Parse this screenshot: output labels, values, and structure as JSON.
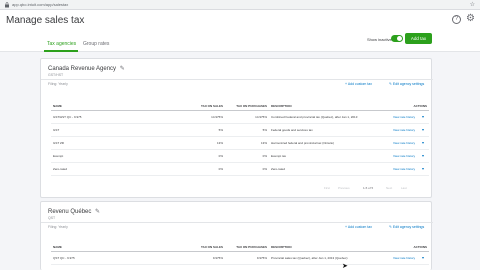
{
  "browser": {
    "url": "app.qbo.intuit.com/app/salestax"
  },
  "header": {
    "title": "Manage sales tax"
  },
  "tabs": [
    {
      "label": "Tax agencies",
      "active": true
    },
    {
      "label": "Group rates",
      "active": false
    }
  ],
  "toolbar": {
    "toggle_label": "Show inactive",
    "add_tax_label": "Add tax"
  },
  "agencies": [
    {
      "name": "Canada Revenue Agency",
      "business_number": "GST/HST",
      "filing_frequency": "Filing: Yearly",
      "add_custom_tax": "Add custom tax",
      "edit_settings": "Edit agency settings",
      "columns": [
        "NAME",
        "TAX ON SALES",
        "TAX ON PURCHASES",
        "DESCRIPTION",
        "ACTIONS"
      ],
      "rows": [
        {
          "name": "GST/HST QC - 9.975",
          "sales": "14.975%",
          "purchases": "14.975%",
          "description": "Combined Federal and provincial tax (Quebec), after Jan 1, 2013",
          "action": "View rate history"
        },
        {
          "name": "GST",
          "sales": "5%",
          "purchases": "5%",
          "description": "Federal goods and services tax",
          "action": "View rate history"
        },
        {
          "name": "GST ZR",
          "sales": "13%",
          "purchases": "13%",
          "description": "Harmonized federal and provincial tax (Ontario)",
          "action": "View rate history"
        },
        {
          "name": "Exempt",
          "sales": "0%",
          "purchases": "0%",
          "description": "Exempt tax",
          "action": "View rate history"
        },
        {
          "name": "Zero-rated",
          "sales": "0%",
          "purchases": "0%",
          "description": "Zero-rated",
          "action": "View rate history"
        }
      ],
      "pager": {
        "first": "First",
        "previous": "Previous",
        "range": "1-5 of 5",
        "next": "Next",
        "last": "Last"
      }
    },
    {
      "name": "Revenu Québec",
      "business_number": "QST",
      "filing_frequency": "Filing: Yearly",
      "add_custom_tax": "Add custom tax",
      "edit_settings": "Edit agency settings",
      "columns": [
        "NAME",
        "TAX ON SALES",
        "TAX ON PURCHASES",
        "DESCRIPTION",
        "ACTIONS"
      ],
      "rows": [
        {
          "name": "QST QC - 9.975",
          "sales": "9.975%",
          "purchases": "9.975%",
          "description": "Provincial sales tax (Quebec), after Jan 1, 2013 (Quebec)",
          "action": "View rate history"
        }
      ]
    }
  ],
  "colors": {
    "accent": "#2ca01c",
    "link": "#0077c5",
    "text": "#393a3d",
    "muted": "#8d9096",
    "background": "#f4f5f8"
  },
  "icons": [
    "lock-icon",
    "star-icon",
    "help-icon",
    "gear-icon",
    "edit-icon",
    "plus-icon",
    "chevron-down-icon",
    "mouse-cursor-icon"
  ]
}
